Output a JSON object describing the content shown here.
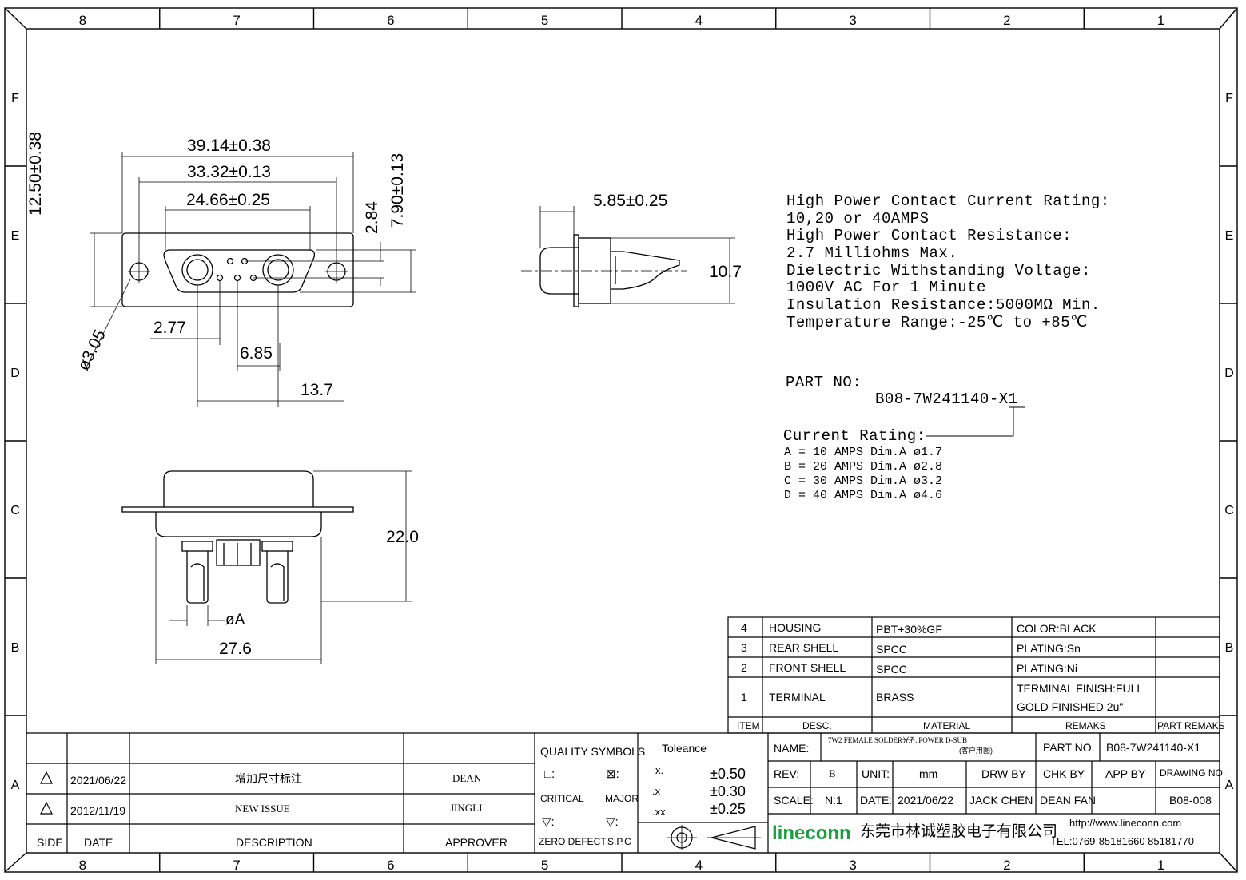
{
  "border": {
    "columns": [
      "8",
      "7",
      "6",
      "5",
      "4",
      "3",
      "2",
      "1"
    ],
    "rows": [
      "F",
      "E",
      "D",
      "C",
      "B",
      "A"
    ]
  },
  "dimensions": {
    "overall_width": "39.14±0.38",
    "mount_hole_spacing": "33.32±0.13",
    "shell_width": "24.66±0.25",
    "overall_height": "12.50±0.38",
    "shell_height": "7.90±0.13",
    "contact_row_spacing": "2.84",
    "mount_hole_dia": "ø3.05",
    "signal_pitch": "2.77",
    "signal_span": "6.85",
    "power_spacing": "13.7",
    "side_depth": "5.85±0.25",
    "side_height": "10.7",
    "bottom_height": "22.0",
    "bottom_pin_dia": "øA",
    "bottom_width": "27.6"
  },
  "specs": [
    "High Power Contact Current Rating:",
    "10,20 or 40AMPS",
    "High Power Contact Resistance:",
    "2.7 Milliohms Max.",
    "Dielectric Withstanding Voltage:",
    "1000V AC For 1 Minute",
    "Insulation Resistance:5000MΩ Min.",
    "Temperature Range:-25℃ to +85℃"
  ],
  "part_no": {
    "label": "PART NO:",
    "value": "B08-7W241140-X1"
  },
  "current_rating": {
    "title": "Current Rating:",
    "rows": [
      "A = 10 AMPS Dim.A ø1.7",
      "B = 20 AMPS Dim.A ø2.8",
      "C = 30 AMPS Dim.A ø3.2",
      "D = 40 AMPS Dim.A ø4.6"
    ]
  },
  "bom": {
    "items": [
      {
        "no": "4",
        "desc": "HOUSING",
        "material": "PBT+30%GF",
        "remark": "COLOR:BLACK",
        "part_remark": ""
      },
      {
        "no": "3",
        "desc": "REAR SHELL",
        "material": "SPCC",
        "remark": "PLATING:Sn",
        "part_remark": ""
      },
      {
        "no": "2",
        "desc": "FRONT SHELL",
        "material": "SPCC",
        "remark": "PLATING:Ni",
        "part_remark": ""
      },
      {
        "no": "1",
        "desc": "TERMINAL",
        "material": "BRASS",
        "remark": "TERMINAL FINISH:FULL",
        "remark2": "GOLD FINISHED 2u\"",
        "part_remark": ""
      }
    ],
    "header": {
      "item": "ITEM",
      "desc": "DESC.",
      "material": "MATERIAL",
      "remarks": "REMAKS",
      "part_remarks": "PART REMAKS"
    }
  },
  "revisions": {
    "rows": [
      {
        "date": "2021/06/22",
        "description": "增加尺寸标注",
        "approver": "DEAN"
      },
      {
        "date": "2012/11/19",
        "description": "NEW ISSUE",
        "approver": "JINGLI"
      }
    ],
    "header": {
      "side": "SIDE",
      "date": "DATE",
      "description": "DESCRIPTION",
      "approver": "APPROVER"
    }
  },
  "quality": {
    "title": "QUALITY SYMBOLS",
    "critical": "CRITICAL",
    "major": "MAJOR",
    "zero_defect": "ZERO DEFECT",
    "spc": "S.P.C",
    "sym_critical": "□:",
    "sym_major": "⊠:",
    "sym_zero": "▽:",
    "sym_spc": "▽:"
  },
  "tolerance": {
    "title": "Toleance",
    "rows": [
      {
        "label": "x.",
        "value": "±0.50"
      },
      {
        "label": ".x",
        "value": "±0.30"
      },
      {
        "label": ".xx",
        "value": "±0.25"
      }
    ]
  },
  "title_block": {
    "name_label": "NAME:",
    "name_value": "7W2 FEMALE SOLDER光孔 POWER D-SUB",
    "name_note": "(客户用图)",
    "part_no_label": "PART NO.",
    "part_no_value": "B08-7W241140-X1",
    "rev_label": "REV:",
    "rev_value": "B",
    "unit_label": "UNIT:",
    "unit_value": "mm",
    "drw_by": "DRW BY",
    "chk_by": "CHK BY",
    "app_by": "APP BY",
    "drawing_no_label": "DRAWING NO.",
    "drawing_no_value": "B08-008",
    "scale_label": "SCALE:",
    "scale_value": "N:1",
    "date_label": "DATE:",
    "date_value": "2021/06/22",
    "drawer": "JACK CHEN",
    "checker": "DEAN FAN",
    "logo": "lineconn",
    "company": "东莞市林诚塑胶电子有限公司",
    "website": "http://www.lineconn.com",
    "tel": "TEL:0769-85181660 85181770"
  }
}
